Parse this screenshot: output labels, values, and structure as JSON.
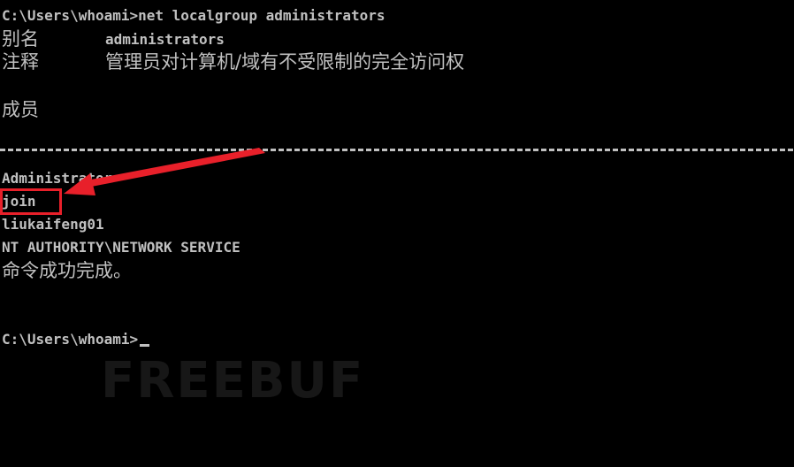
{
  "terminal": {
    "prompt_line": "C:\\Users\\whoami>net localgroup administrators",
    "alias_label": "别名",
    "alias_value": "administrators",
    "comment_label": "注释",
    "comment_value": "管理员对计算机/域有不受限制的完全访问权",
    "members_label": "成员",
    "members": [
      "Administrator",
      "join",
      "liukaifeng01",
      "NT AUTHORITY\\NETWORK SERVICE"
    ],
    "completion_message": "命令成功完成。",
    "final_prompt": "C:\\Users\\whoami>"
  },
  "annotation": {
    "highlighted_member": "join",
    "box_color": "#e8202a",
    "arrow_color": "#e8202a"
  },
  "watermark": {
    "text": "FREEBUF"
  },
  "colors": {
    "background": "#000000",
    "text": "#c0c0c0"
  }
}
